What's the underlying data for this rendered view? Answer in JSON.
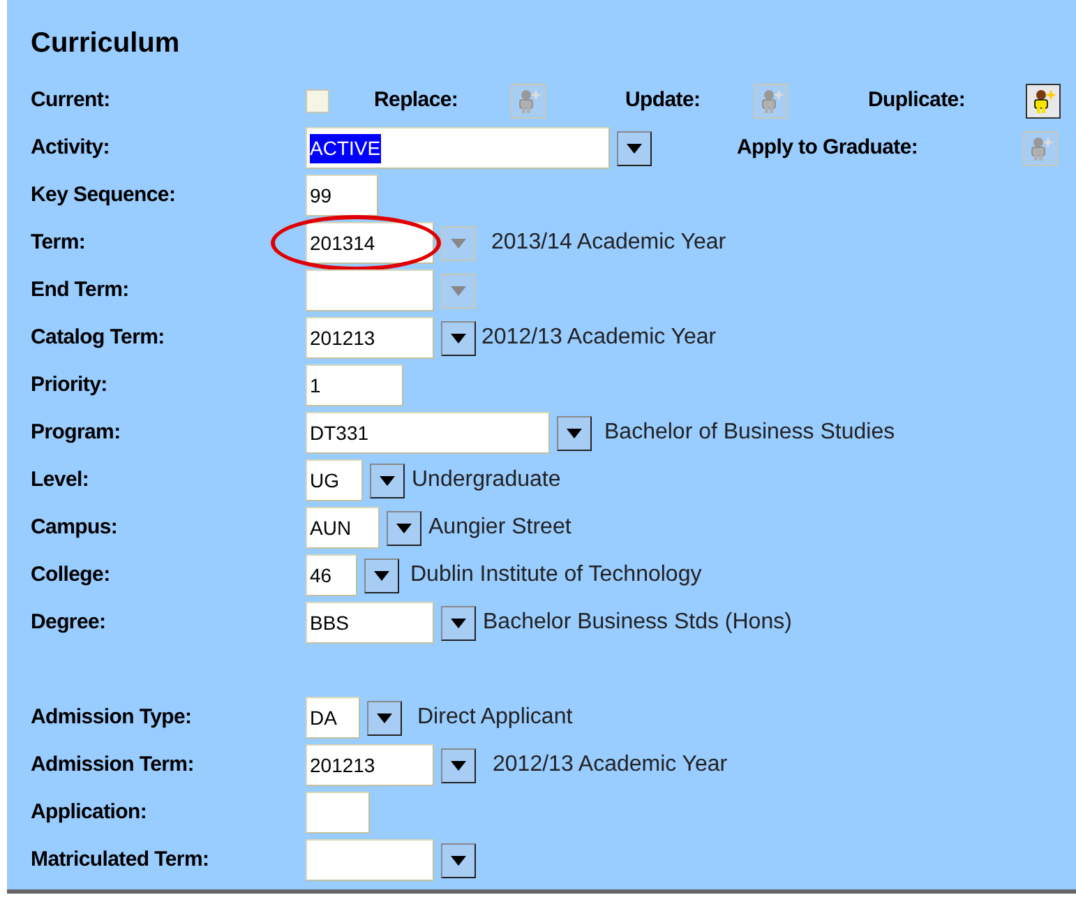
{
  "title": "Curriculum",
  "current": {
    "label": "Current:",
    "checked": false
  },
  "actions": [
    {
      "label": "Replace:",
      "enabled": false
    },
    {
      "label": "Update:",
      "enabled": false
    },
    {
      "label": "Duplicate:",
      "enabled": true
    }
  ],
  "apply_to_graduate": {
    "label": "Apply to Graduate:",
    "enabled": false
  },
  "fields": [
    {
      "label": "Activity:",
      "value": "ACTIVE",
      "text_selected": true,
      "dropdown_enabled": true
    },
    {
      "label": "Key Sequence:",
      "value": "99"
    },
    {
      "label": "Term:",
      "value": "201314",
      "dropdown_enabled": false,
      "description": "2013/14 Academic Year",
      "circled": true
    },
    {
      "label": "End Term:",
      "dropdown_enabled": false
    },
    {
      "label": "Catalog Term:",
      "value": "201213",
      "dropdown_enabled": true,
      "description": "2012/13 Academic Year"
    },
    {
      "label": "Priority:",
      "value": "1"
    },
    {
      "label": "Program:",
      "value": "DT331",
      "dropdown_enabled": true,
      "description": "Bachelor of Business Studies"
    },
    {
      "label": "Level:",
      "value": "UG",
      "dropdown_enabled": true,
      "description": "Undergraduate"
    },
    {
      "label": "Campus:",
      "value": "AUN",
      "dropdown_enabled": true,
      "description": "Aungier Street"
    },
    {
      "label": "College:",
      "value": "46",
      "dropdown_enabled": true,
      "description": "Dublin Institute of Technology"
    },
    {
      "label": "Degree:",
      "value": "BBS",
      "dropdown_enabled": true,
      "description": "Bachelor Business Stds (Hons)"
    }
  ],
  "admission_fields": [
    {
      "label": "Admission Type:",
      "value": "DA",
      "dropdown_enabled": true,
      "description": "Direct Applicant"
    },
    {
      "label": "Admission Term:",
      "value": "201213",
      "dropdown_enabled": true,
      "description": "2012/13 Academic Year"
    },
    {
      "label": "Application:"
    },
    {
      "label": "Matriculated Term:",
      "dropdown_enabled": true
    }
  ]
}
